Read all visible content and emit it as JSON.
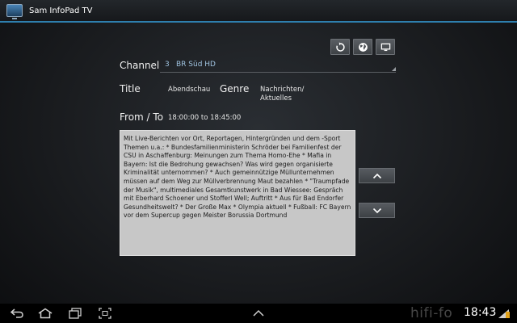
{
  "app": {
    "title": "Sam InfoPad TV"
  },
  "toolbar": {
    "refresh_icon": "refresh-icon",
    "globe_icon": "globe-icon",
    "monitor_icon": "monitor-icon"
  },
  "fields": {
    "channel_label": "Channel",
    "channel_number": "3",
    "channel_name": "BR Süd HD",
    "title_label": "Title",
    "title_value": "Abendschau",
    "genre_label": "Genre",
    "genre_value_line1": "Nachrichten/",
    "genre_value_line2": "Aktuelles",
    "time_label": "From / To",
    "time_value": "18:00:00 to 18:45:00"
  },
  "description": "Mit Live-Berichten vor Ort, Reportagen, Hintergründen und dem -Sport Themen u.a.: * Bundesfamilienministerin Schröder bei Familienfest der CSU in Aschaffenburg: Meinungen zum Thema Homo-Ehe * Mafia in Bayern: Ist die Bedrohung gewachsen? Was wird gegen organisierte Kriminalität unternommen? * Auch gemeinnützige Müllunternehmen müssen auf dem Weg zur Müllverbrennung Maut bezahlen * \"Traumpfade der Musik\", multimediales Gesamtkunstwerk in Bad Wiessee: Gespräch mit Eberhard Schoener und Stofferl Well; Auftritt * Aus für Bad Endorfer Gesundheitswelt? * Der Große Max * Olympia aktuell * Fußball: FC Bayern vor dem Supercup gegen Meister Borussia Dortmund",
  "statusbar": {
    "clock": "18:43"
  },
  "watermark": "hifi-fo"
}
